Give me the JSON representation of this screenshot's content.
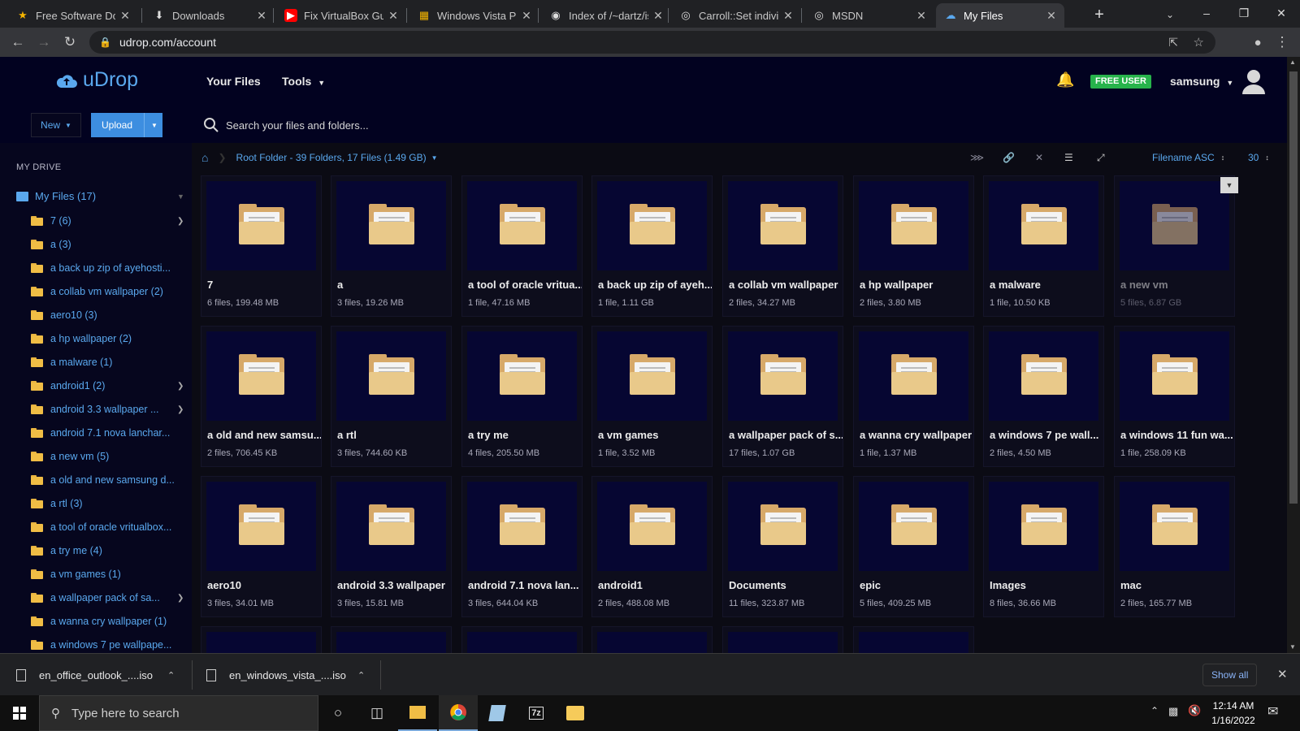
{
  "browser": {
    "tabs": [
      {
        "title": "Free Software Dow",
        "icon": "star-icon"
      },
      {
        "title": "Downloads",
        "icon": "download-icon"
      },
      {
        "title": "Fix VirtualBox Gue",
        "icon": "youtube-icon"
      },
      {
        "title": "Windows Vista Pro",
        "icon": "windows-icon"
      },
      {
        "title": "Index of /~dartz/is",
        "icon": "page-icon"
      },
      {
        "title": "Carroll::Set individ",
        "icon": "globe-icon"
      },
      {
        "title": "MSDN",
        "icon": "globe-icon"
      },
      {
        "title": "My Files",
        "icon": "udrop-icon"
      }
    ],
    "url": "udrop.com/account"
  },
  "app": {
    "logo_text": "uDrop",
    "nav": {
      "your_files": "Your Files",
      "tools": "Tools"
    },
    "badge": "FREE USER",
    "user": "samsung",
    "new_label": "New",
    "upload_label": "Upload",
    "search_placeholder": "Search your files and folders...",
    "accent": "#5aa8ee",
    "badge_color": "#27b34b"
  },
  "sidebar": {
    "heading": "MY DRIVE",
    "root": "My Files (17)",
    "items": [
      {
        "label": "7 (6)",
        "chevron": true
      },
      {
        "label": "a (3)",
        "chevron": false
      },
      {
        "label": "a back up zip of ayehosti...",
        "chevron": false
      },
      {
        "label": "a collab vm wallpaper (2)",
        "chevron": false
      },
      {
        "label": "aero10 (3)",
        "chevron": false
      },
      {
        "label": "a hp wallpaper (2)",
        "chevron": false
      },
      {
        "label": "a malware (1)",
        "chevron": false
      },
      {
        "label": "android1 (2)",
        "chevron": true
      },
      {
        "label": "android 3.3 wallpaper ...",
        "chevron": true
      },
      {
        "label": "android 7.1 nova lanchar...",
        "chevron": false
      },
      {
        "label": "a new vm (5)",
        "chevron": false
      },
      {
        "label": "a old and new samsung d...",
        "chevron": false
      },
      {
        "label": "a rtl (3)",
        "chevron": false
      },
      {
        "label": "a tool of oracle vritualbox...",
        "chevron": false
      },
      {
        "label": "a try me (4)",
        "chevron": false
      },
      {
        "label": "a vm games (1)",
        "chevron": false
      },
      {
        "label": "a wallpaper pack of sa...",
        "chevron": true
      },
      {
        "label": "a wanna cry wallpaper (1)",
        "chevron": false
      },
      {
        "label": "a windows 7 pe wallpape...",
        "chevron": false
      }
    ]
  },
  "main": {
    "breadcrumb": "Root Folder - 39 Folders, 17 Files (1.49 GB)",
    "sort": "Filename ASC",
    "per_page": "30",
    "folders": [
      {
        "name": "7",
        "meta": "6 files, 199.48 MB"
      },
      {
        "name": "a",
        "meta": "3 files, 19.26 MB"
      },
      {
        "name": "a tool of oracle vritua...",
        "meta": "1 file, 47.16 MB"
      },
      {
        "name": "a back up zip of ayeh...",
        "meta": "1 file, 1.11 GB"
      },
      {
        "name": "a collab vm wallpaper",
        "meta": "2 files, 34.27 MB"
      },
      {
        "name": "a hp wallpaper",
        "meta": "2 files, 3.80 MB"
      },
      {
        "name": "a malware",
        "meta": "1 file, 10.50 KB"
      },
      {
        "name": "a new vm",
        "meta": "5 files, 6.87 GB"
      },
      {
        "name": "a old and new samsu...",
        "meta": "2 files, 706.45 KB"
      },
      {
        "name": "a rtl",
        "meta": "3 files, 744.60 KB"
      },
      {
        "name": "a try me",
        "meta": "4 files, 205.50 MB"
      },
      {
        "name": "a vm games",
        "meta": "1 file, 3.52 MB"
      },
      {
        "name": "a wallpaper pack of s...",
        "meta": "17 files, 1.07 GB"
      },
      {
        "name": "a wanna cry wallpaper",
        "meta": "1 file, 1.37 MB"
      },
      {
        "name": "a windows 7 pe wall...",
        "meta": "2 files, 4.50 MB"
      },
      {
        "name": "a windows 11 fun wa...",
        "meta": "1 file, 258.09 KB"
      },
      {
        "name": "aero10",
        "meta": "3 files, 34.01 MB"
      },
      {
        "name": "android 3.3 wallpaper",
        "meta": "3 files, 15.81 MB"
      },
      {
        "name": "android 7.1 nova lan...",
        "meta": "3 files, 644.04 KB"
      },
      {
        "name": "android1",
        "meta": "2 files, 488.08 MB"
      },
      {
        "name": "Documents",
        "meta": "11 files, 323.87 MB"
      },
      {
        "name": "epic",
        "meta": "5 files, 409.25 MB"
      },
      {
        "name": "Images",
        "meta": "8 files, 36.66 MB"
      },
      {
        "name": "mac",
        "meta": "2 files, 165.77 MB"
      }
    ]
  },
  "downloads": {
    "items": [
      "en_office_outlook_....iso",
      "en_windows_vista_....iso"
    ],
    "show_all": "Show all"
  },
  "taskbar": {
    "search_placeholder": "Type here to search",
    "time": "12:14 AM",
    "date": "1/16/2022"
  }
}
